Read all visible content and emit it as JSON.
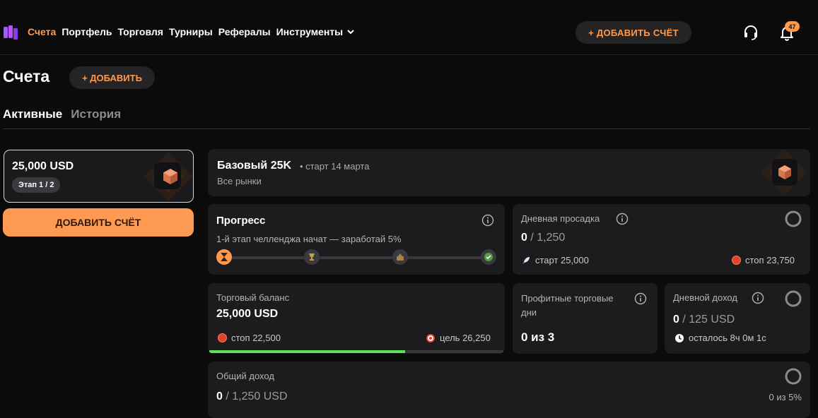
{
  "nav": {
    "items": [
      "Счета",
      "Портфель",
      "Торговля",
      "Турниры",
      "Рефералы"
    ],
    "tools_label": "Инструменты",
    "add_account_label": "+ ДОБАВИТЬ СЧЁТ",
    "notifications_count": "47"
  },
  "page": {
    "title": "Счета",
    "add_label": "+ ДОБАВИТЬ",
    "tabs": [
      "Активные",
      "История"
    ]
  },
  "account_card": {
    "amount": "25,000 USD",
    "stage": "Этап 1 / 2",
    "add_button": "ДОБАВИТЬ СЧЁТ"
  },
  "header_card": {
    "title": "Базовый 25K",
    "start": "• старт 14 марта",
    "subtitle": "Все рынки"
  },
  "progress": {
    "title": "Прогресс",
    "description": "1-й этап челленджа начат — заработай 5%"
  },
  "drawdown": {
    "label": "Дневная просадка",
    "value": "0",
    "limit": " / 1,250",
    "start": "старт 25,000",
    "stop": "стоп 23,750"
  },
  "balance": {
    "label": "Торговый баланс",
    "value": "25,000 USD",
    "stop": "стоп 22,500",
    "target": "цель 26,250",
    "progress_fraction": 0.667
  },
  "profit_days": {
    "label": "Профитные торговые дни",
    "value": "0 из 3"
  },
  "daily_income": {
    "label": "Дневной доход",
    "value": "0",
    "limit": " / 125 USD",
    "remaining": "осталось 8ч 0м 1с"
  },
  "total_income": {
    "label": "Общий доход",
    "value": "0",
    "limit": " / 1,250 USD",
    "percent": "0 из 5%"
  },
  "colors": {
    "accent": "#ff9a4d",
    "progress_green": "#5ee05a",
    "stop_red": "#e0442a"
  }
}
